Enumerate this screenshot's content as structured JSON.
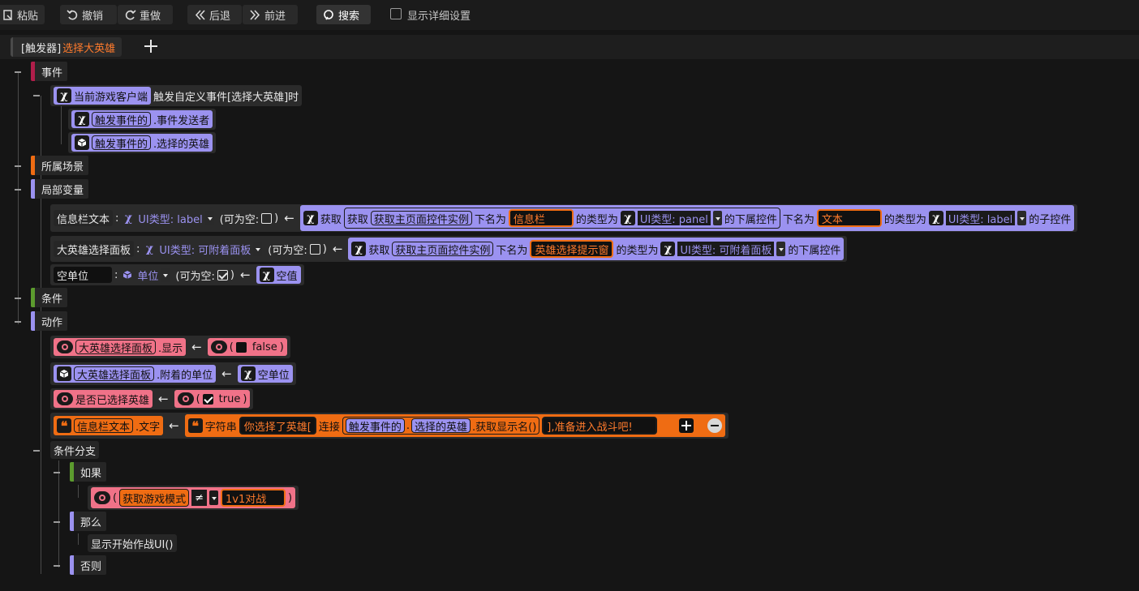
{
  "toolbar": {
    "paste": "粘贴",
    "undo": "撤销",
    "redo": "重做",
    "back": "后退",
    "forward": "前进",
    "search": "搜索",
    "show_details": "显示详细设置"
  },
  "tab": {
    "prefix": "[触发器]",
    "name": "选择大英雄"
  },
  "sections": {
    "event": "事件",
    "scene": "所属场景",
    "locals": "局部变量",
    "condition": "条件",
    "action": "动作",
    "branch": "条件分支",
    "if": "如果",
    "then": "那么",
    "else": "否则"
  },
  "event_block": {
    "client": "当前游戏客户端",
    "desc": "触发自定义事件[选择大英雄]时",
    "p1_src": "触发事件的",
    "p1_prop": ".事件发送者",
    "p2_src": "触发事件的",
    "p2_prop": ".选择的英雄"
  },
  "locals": {
    "v1": {
      "name": "信息栏文本",
      "colon": ":",
      "type": "UI类型: label",
      "nullable": "(可为空:",
      "close": ")",
      "get": "获取",
      "get2": "获取",
      "get3": "获取主页面控件实例",
      "down_named": "下名为",
      "str1": "信息栏",
      "type_is": "的类型为",
      "type1": "UI类型: panel",
      "sub_ctrl": "的下属控件",
      "down_named2": "下名为",
      "str2": "文本",
      "type_is2": "的类型为",
      "type2": "UI类型: label",
      "child_ctrl": "的子控件"
    },
    "v2": {
      "name": "大英雄选择面板",
      "colon": ":",
      "type": "UI类型: 可附着面板",
      "nullable": "(可为空:",
      "close": ")",
      "get": "获取",
      "get2": "获取主页面控件实例",
      "down_named": "下名为",
      "str1": "英雄选择提示窗",
      "type_is": "的类型为",
      "type1": "UI类型: 可附着面板",
      "sub_ctrl": "的下属控件"
    },
    "v3": {
      "name": "空单位",
      "colon": ":",
      "type": "单位",
      "nullable": "(可为空:",
      "close": ")",
      "value": "空值"
    }
  },
  "actions": {
    "a1": {
      "target": "大英雄选择面板",
      "prop": ".显示",
      "paren": "(",
      "value": "false",
      "close": ")"
    },
    "a2": {
      "target": "大英雄选择面板",
      "prop": ".附着的单位",
      "value": "空单位"
    },
    "a3": {
      "target": "是否已选择英雄",
      "paren": "(",
      "value": "true",
      "close": ")"
    },
    "a4": {
      "target": "信息栏文本",
      "prop": ".文字",
      "kind": "字符串",
      "s1": "你选择了英雄[",
      "concat": "连接",
      "src": "触发事件的",
      "dot": ".",
      "prop2": "选择的英雄",
      "method": ".获取显示名()",
      "s2": "],准备进入战斗吧!"
    }
  },
  "branch": {
    "cond_paren": "(",
    "cond_fn": "获取游戏模式",
    "cond_op": "≠",
    "cond_val": "1v1对战",
    "cond_close": ")",
    "then_action": "显示开始作战UI()"
  },
  "colors": {
    "event": "#b01e4a",
    "scene": "#ef6c13",
    "locals": "#9b92f0",
    "condition": "#5c9b2e",
    "action": "#9b92f0",
    "if": "#5c9b2e",
    "then": "#9b92f0",
    "else": "#9b92f0"
  }
}
